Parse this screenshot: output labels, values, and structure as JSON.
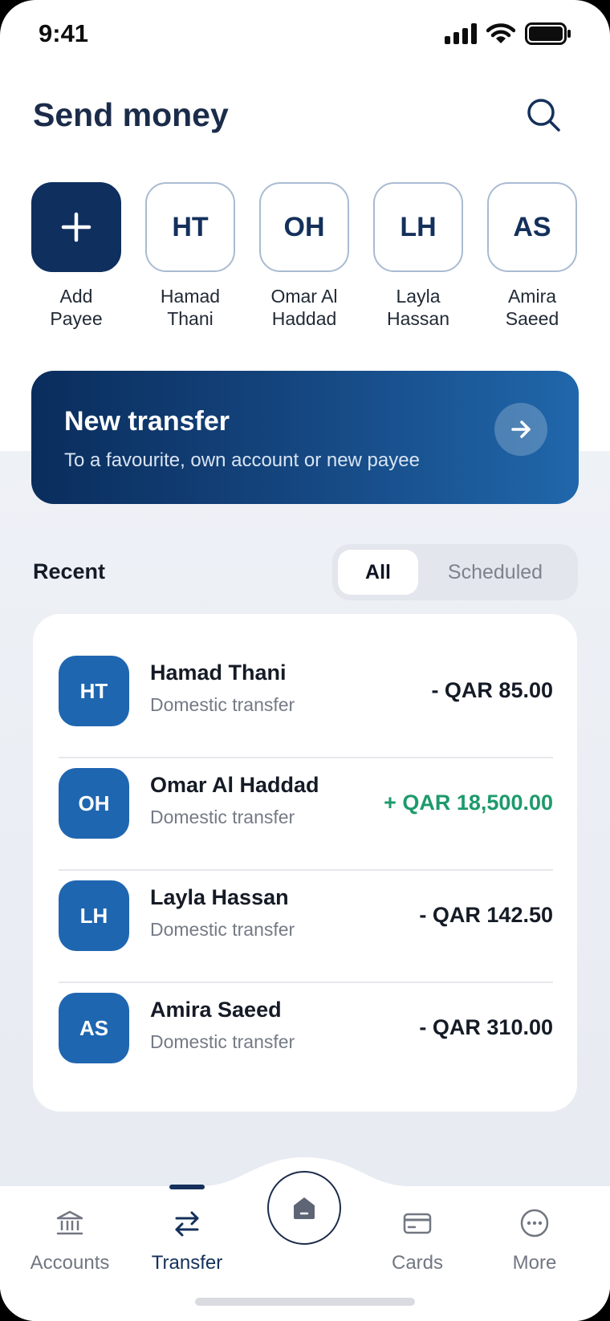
{
  "status_bar": {
    "time": "9:41"
  },
  "header": {
    "title": "Send money"
  },
  "payees": [
    {
      "initials": "",
      "label_line1": "Add",
      "label_line2": "Payee",
      "is_add": true
    },
    {
      "initials": "HT",
      "label_line1": "Hamad",
      "label_line2": "Thani"
    },
    {
      "initials": "OH",
      "label_line1": "Omar Al",
      "label_line2": "Haddad"
    },
    {
      "initials": "LH",
      "label_line1": "Layla",
      "label_line2": "Hassan"
    },
    {
      "initials": "AS",
      "label_line1": "Amira",
      "label_line2": "Saeed"
    }
  ],
  "banner": {
    "title": "New transfer",
    "subtitle": "To a favourite, own account or new payee"
  },
  "recent": {
    "title": "Recent",
    "tabs": [
      {
        "label": "All",
        "active": true
      },
      {
        "label": "Scheduled",
        "active": false
      }
    ]
  },
  "transactions": [
    {
      "initials": "HT",
      "name": "Hamad Thani",
      "type": "Domestic transfer",
      "amount": "- QAR 85.00",
      "direction": "debit"
    },
    {
      "initials": "OH",
      "name": "Omar Al Haddad",
      "type": "Domestic transfer",
      "amount": "+ QAR 18,500.00",
      "direction": "credit"
    },
    {
      "initials": "LH",
      "name": "Layla Hassan",
      "type": "Domestic transfer",
      "amount": "- QAR 142.50",
      "direction": "debit"
    },
    {
      "initials": "AS",
      "name": "Amira Saeed",
      "type": "Domestic transfer",
      "amount": "- QAR 310.00",
      "direction": "debit"
    }
  ],
  "bottom_nav": {
    "items": [
      {
        "label": "Accounts",
        "icon": "bank-icon"
      },
      {
        "label": "Transfer",
        "icon": "transfer-arrows-icon",
        "active": true
      },
      {
        "label": "",
        "icon": "home-icon"
      },
      {
        "label": "Cards",
        "icon": "card-icon"
      },
      {
        "label": "More",
        "icon": "more-dots-icon"
      }
    ]
  },
  "colors": {
    "primary": "#0f2f5f",
    "accent_blue": "#1f66b1",
    "credit_green": "#1e9a6c",
    "text_dark": "#151b26",
    "text_muted": "#747b86"
  }
}
